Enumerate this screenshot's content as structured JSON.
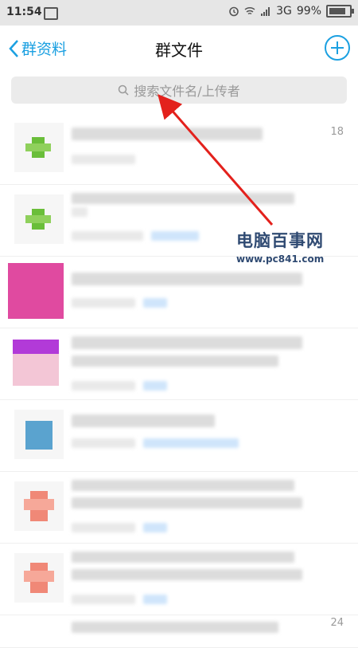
{
  "status_bar": {
    "time": "11:54",
    "network": "3G",
    "battery": "99%"
  },
  "nav": {
    "back_label": "群资料",
    "title": "群文件"
  },
  "search": {
    "placeholder": "搜索文件名/上传者"
  },
  "files": [
    {
      "thumb_color": "#6abe3a",
      "stamp": "18"
    },
    {
      "thumb_color": "#6abe3a",
      "stamp": ""
    },
    {
      "thumb_color": "#e04aa0",
      "stamp": ""
    },
    {
      "thumb_color": "#b23ad8",
      "stamp": ""
    },
    {
      "thumb_color": "#5aa3cf",
      "stamp": ""
    },
    {
      "thumb_color": "#f08877",
      "stamp": ""
    },
    {
      "thumb_color": "#f08877",
      "stamp": ""
    }
  ],
  "last_row_stamp": "24",
  "watermark": {
    "name": "电脑百事网",
    "url": "www.pc841.com"
  },
  "colors": {
    "accent": "#1ba0e1",
    "arrow": "#e3211c"
  }
}
